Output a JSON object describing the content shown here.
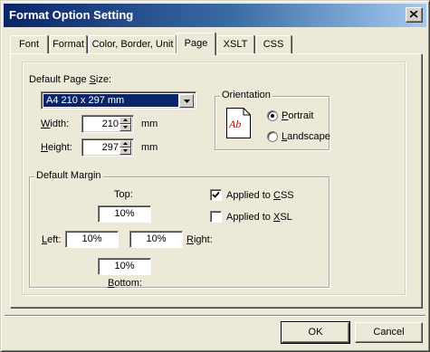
{
  "window": {
    "title": "Format Option Setting",
    "close_icon": "close-icon"
  },
  "tabs": [
    {
      "label": "Font",
      "active": false
    },
    {
      "label": "Format",
      "active": false
    },
    {
      "label": "Color, Border, Unit",
      "active": false
    },
    {
      "label": "Page",
      "active": true
    },
    {
      "label": "XSLT",
      "active": false
    },
    {
      "label": "CSS",
      "active": false
    }
  ],
  "page": {
    "page_size_label_pre": "Default Page ",
    "page_size_label_u": "S",
    "page_size_label_post": "ize:",
    "page_size_value": "A4 210 x 297 mm",
    "width_label_u": "W",
    "width_label_post": "idth:",
    "width_value": "210",
    "width_unit": "mm",
    "height_label_u": "H",
    "height_label_post": "eight:",
    "height_value": "297",
    "height_unit": "mm",
    "orientation": {
      "label": "Orientation",
      "icon_text": "Ab",
      "portrait_u": "P",
      "portrait_post": "ortrait",
      "landscape_u": "L",
      "landscape_post": "andscape",
      "selected": "Portrait"
    },
    "margin": {
      "label": "Default Margin",
      "top_label": "Top:",
      "top_value": "10%",
      "left_u": "L",
      "left_post": "eft:",
      "left_value": "10%",
      "right_value": "10%",
      "right_u": "R",
      "right_post": "ight:",
      "bottom_u": "B",
      "bottom_post": "ottom:",
      "bottom_value": "10%",
      "applied_css_pre": "Applied to ",
      "applied_css_u": "C",
      "applied_css_post": "SS",
      "applied_css_checked": true,
      "applied_xsl_pre": "Applied to ",
      "applied_xsl_u": "X",
      "applied_xsl_post": "SL",
      "applied_xsl_checked": false
    }
  },
  "buttons": {
    "ok": "OK",
    "cancel": "Cancel"
  },
  "colors": {
    "title_start": "#0a246a",
    "title_end": "#a6caf0",
    "selection": "#0a246a",
    "icon_red": "#c00000"
  }
}
